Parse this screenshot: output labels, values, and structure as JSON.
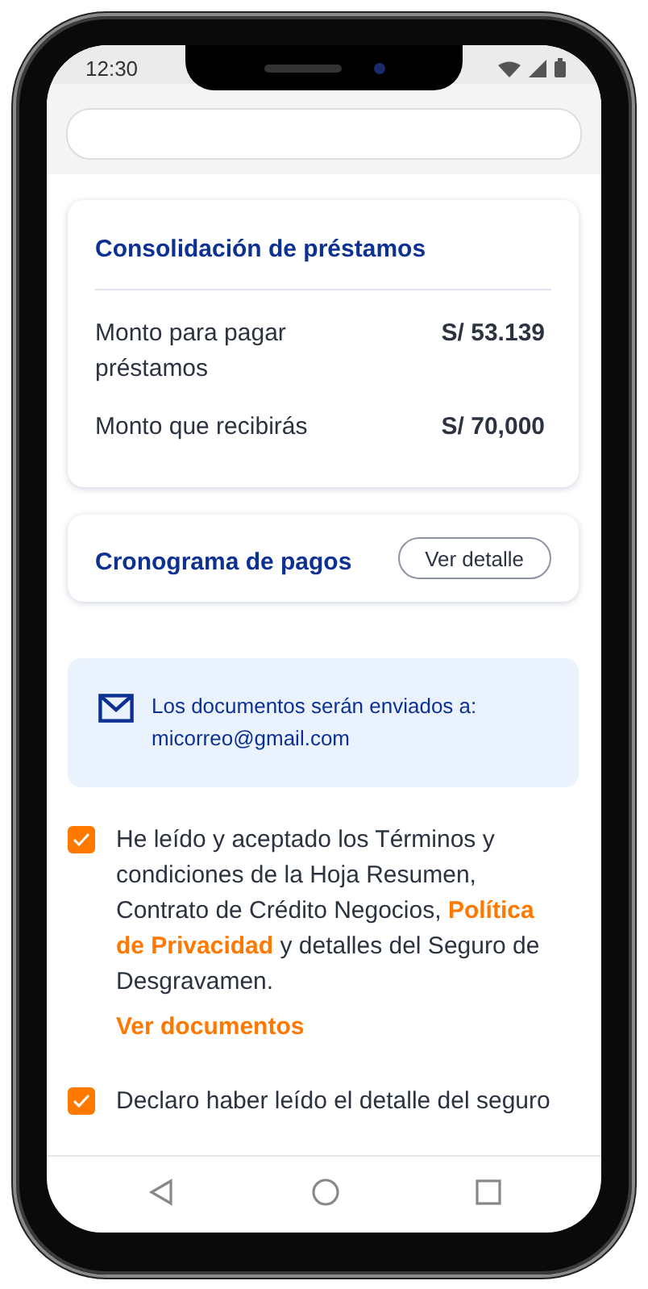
{
  "status_bar": {
    "time": "12:30"
  },
  "summary_card": {
    "title": "Consolidación de préstamos",
    "rows": [
      {
        "label": "Monto para pagar préstamos",
        "value": "S/ 53.139"
      },
      {
        "label": "Monto que recibirás",
        "value": "S/ 70,000"
      }
    ]
  },
  "schedule_card": {
    "title": "Cronograma de pagos",
    "button": "Ver detalle"
  },
  "notice": {
    "text": "Los documentos serán enviados a:",
    "email": "micorreo@gmail.com"
  },
  "consents": [
    {
      "text": "He leído y aceptado los Términos y condiciones de la Hoja Resumen, Contrato de Crédito Negocios, **Política de Privacidad** y detalles del Seguro de Desgravamen.",
      "checked": true,
      "link": "Ver documentos"
    },
    {
      "text": "Declaro haber leído el detalle del seguro",
      "checked": true
    }
  ]
}
